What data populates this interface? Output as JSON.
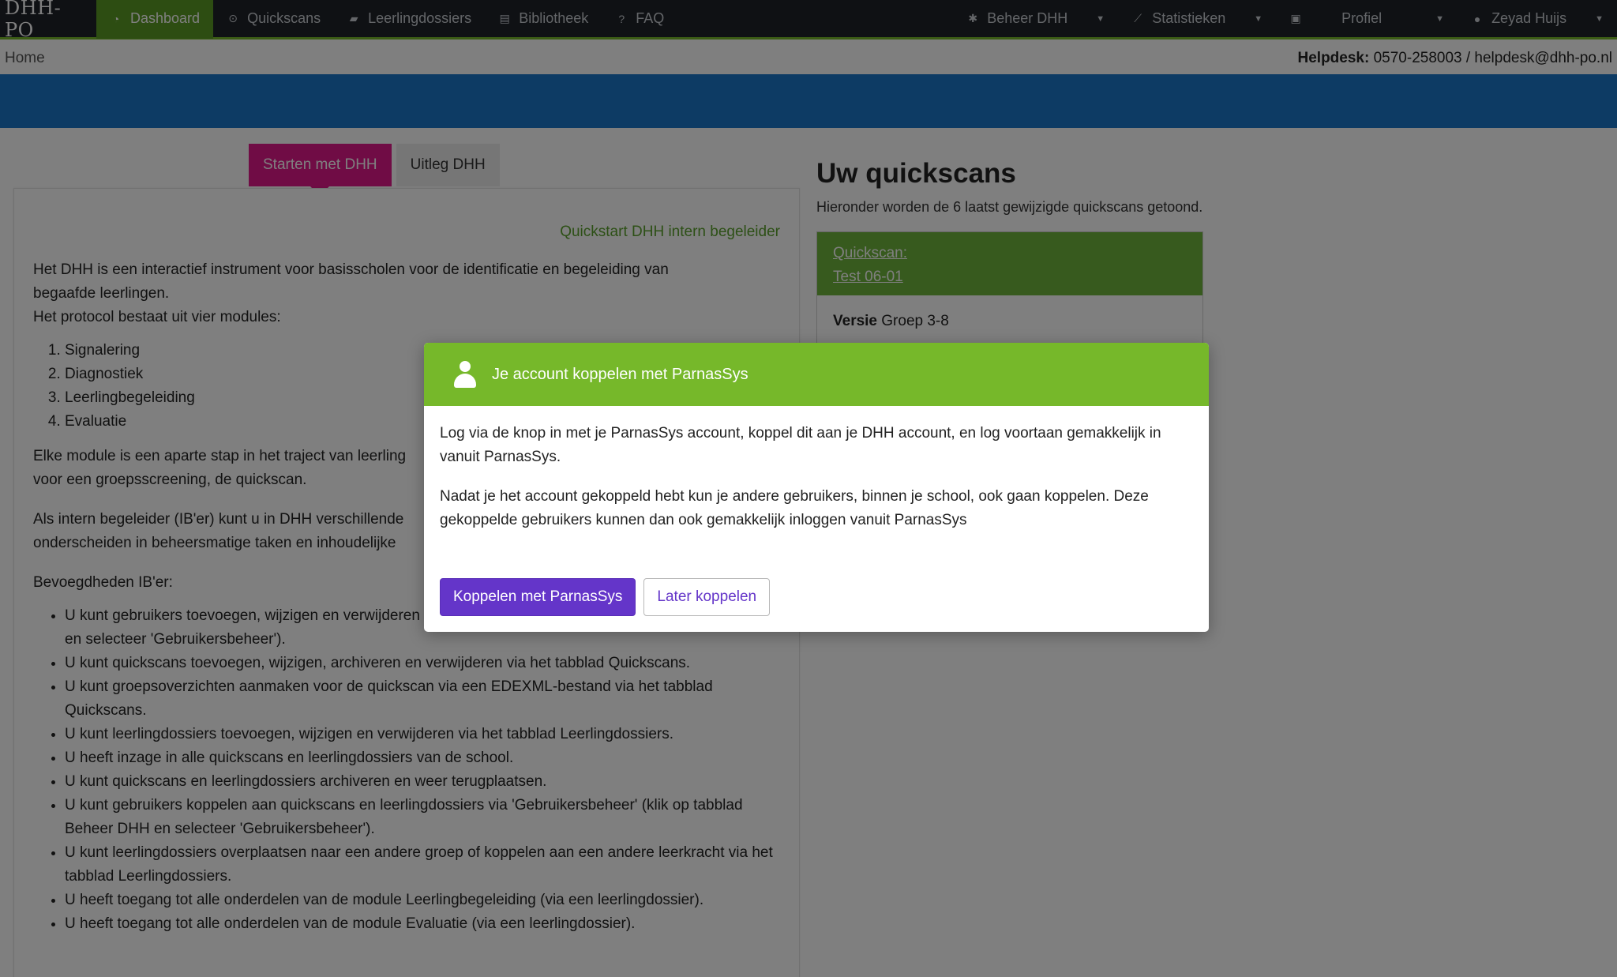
{
  "brand": {
    "name": "DHH-PO"
  },
  "nav": {
    "left": [
      {
        "label": "Dashboard",
        "icon": "dashboard-icon",
        "active": true
      },
      {
        "label": "Quickscans",
        "icon": "clock-icon"
      },
      {
        "label": "Leerlingdossiers",
        "icon": "folder-icon"
      },
      {
        "label": "Bibliotheek",
        "icon": "book-icon"
      },
      {
        "label": "FAQ",
        "icon": "question-icon"
      }
    ],
    "right": [
      {
        "label": "Beheer DHH",
        "icon": "gear-icon"
      },
      {
        "label": "Statistieken",
        "icon": "chart-icon"
      },
      {
        "label": "Profiel",
        "icon": "id-card-icon"
      },
      {
        "label": "Zeyad Huijs",
        "icon": "user-icon"
      }
    ]
  },
  "breadcrumb": {
    "home": "Home"
  },
  "helpdesk": {
    "label": "Helpdesk:",
    "value": "0570-258003 / helpdesk@dhh-po.nl"
  },
  "tabs": {
    "active": "Starten met DHH",
    "inactive": "Uitleg DHH"
  },
  "content": {
    "quickstart": "Quickstart DHH intern begeleider",
    "intro1": "Het DHH is een interactief instrument voor basisscholen voor de identificatie en begeleiding van",
    "intro2": "begaafde leerlingen.",
    "intro3": "Het protocol bestaat uit vier modules:",
    "modules": [
      "Signalering",
      "Diagnostiek",
      "Leerlingbegeleiding",
      "Evaluatie"
    ],
    "para2a": "Elke module is een aparte stap in het traject van leerling",
    "para2b": "voor een groepsscreening, de quickscan.",
    "para3a": "Als intern begeleider (IB'er) kunt u in DHH verschillende",
    "para3b": "onderscheiden in beheersmatige taken en inhoudelijke",
    "bevoegdheden": "Bevoegdheden IB'er:",
    "bullets": [
      "U kunt gebruikers toevoegen, wijzigen en verwijderen via 'Gebruikersbeheer' (klik op tabblad Beheer DHH en selecteer 'Gebruikersbeheer').",
      "U kunt quickscans toevoegen, wijzigen, archiveren en verwijderen via het tabblad Quickscans.",
      "U kunt groepsoverzichten aanmaken voor de quickscan via een EDEXML-bestand via het tabblad Quickscans.",
      "U kunt leerlingdossiers toevoegen, wijzigen en verwijderen via het tabblad Leerlingdossiers.",
      "U heeft inzage in alle quickscans en leerlingdossiers van de school.",
      "U kunt quickscans en leerlingdossiers archiveren en weer terugplaatsen.",
      "U kunt gebruikers koppelen aan quickscans en leerlingdossiers via 'Gebruikersbeheer' (klik op tabblad Beheer DHH en selecteer 'Gebruikersbeheer').",
      "U kunt leerlingdossiers overplaatsen naar een andere groep of koppelen aan een andere leerkracht via het tabblad Leerlingdossiers.",
      "U heeft toegang tot alle onderdelen van de module Leerlingbegeleiding (via een leerlingdossier).",
      "U heeft toegang tot alle onderdelen van de module Evaluatie (via een leerlingdossier)."
    ]
  },
  "quickscans": {
    "title": "Uw quickscans",
    "subtitle": "Hieronder worden de 6 laatst gewijzigde quickscans getoond.",
    "card": {
      "line1": "Quickscan:",
      "line2": "Test 06-01",
      "versie_label": "Versie",
      "versie_value": "Groep 3-8"
    }
  },
  "modal": {
    "title": "Je account koppelen met ParnasSys",
    "p1": "Log via de knop in met je ParnasSys account, koppel dit aan je DHH account, en log voortaan gemakkelijk in vanuit ParnasSys.",
    "p2": "Nadat je het account gekoppeld hebt kun je andere gebruikers, binnen je school, ook gaan koppelen. Deze gekoppelde gebruikers kunnen dan ook gemakkelijk inloggen vanuit ParnasSys",
    "primary_button": "Koppelen met ParnasSys",
    "secondary_button": "Later koppelen"
  },
  "colors": {
    "navbar": "#1f2328",
    "accent_green": "#76b82a",
    "band_blue": "#1b76c8",
    "tab_pink": "#e0188a",
    "button_purple": "#6435c9"
  }
}
